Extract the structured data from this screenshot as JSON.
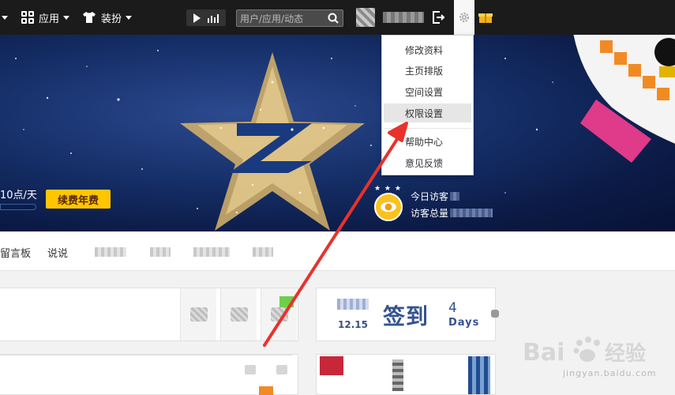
{
  "topbar": {
    "apps_label": "应用",
    "dress_label": "装扮",
    "search_placeholder": "用户/应用/动态"
  },
  "banner": {
    "vip_text": "10点/天",
    "renew_label": "续费年费",
    "visitor_today_label": "今日访客",
    "visitor_total_label": "访客总量"
  },
  "nav": {
    "items": [
      "留言板",
      "说说"
    ]
  },
  "menu": {
    "items": [
      "修改资料",
      "主页排版",
      "空间设置",
      "权限设置",
      "帮助中心",
      "意见反馈"
    ],
    "highlighted": "权限设置"
  },
  "signin": {
    "date": "12.15",
    "label": "签到",
    "streak_days": "4",
    "streak_unit": "Days"
  },
  "watermark": {
    "brand": "Bai 经验",
    "url": "jingyan.baidu.com"
  },
  "colors": {
    "topbar_bg": "#1b1b1b",
    "renew_button": "#ffc600",
    "arrow": "#e8322b",
    "signin_text": "#34538f"
  }
}
